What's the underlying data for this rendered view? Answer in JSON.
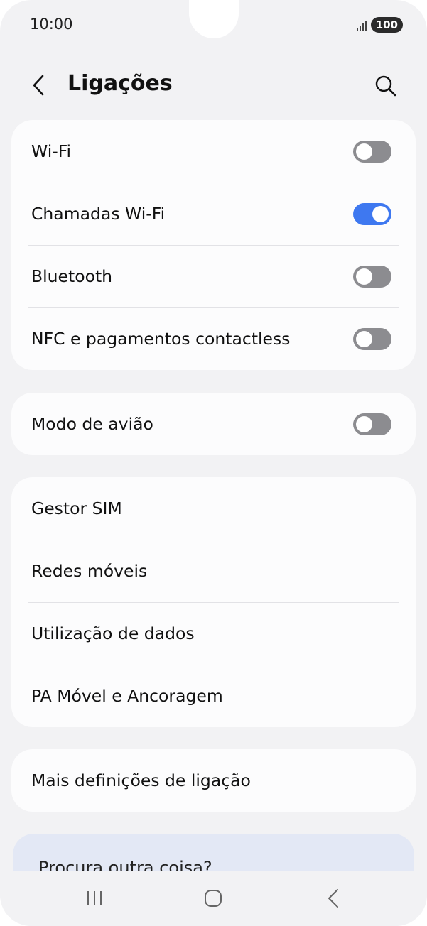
{
  "status_bar": {
    "time": "10:00",
    "battery": "100"
  },
  "header": {
    "title": "Ligações"
  },
  "cards": [
    {
      "rows": [
        {
          "label": "Wi-Fi",
          "toggle": "off"
        },
        {
          "label": "Chamadas Wi-Fi",
          "toggle": "on"
        },
        {
          "label": "Bluetooth",
          "toggle": "off"
        },
        {
          "label": "NFC e pagamentos contactless",
          "toggle": "off"
        }
      ]
    },
    {
      "rows": [
        {
          "label": "Modo de avião",
          "toggle": "off"
        }
      ]
    },
    {
      "rows": [
        {
          "label": "Gestor SIM"
        },
        {
          "label": "Redes móveis"
        },
        {
          "label": "Utilização de dados"
        },
        {
          "label": "PA Móvel e Ancoragem"
        }
      ]
    },
    {
      "rows": [
        {
          "label": "Mais definições de ligação"
        }
      ]
    }
  ],
  "suggestion": {
    "text": "Procura outra coisa?"
  },
  "colors": {
    "toggle_on": "#3e78f0",
    "toggle_off": "#8c8c90",
    "background": "#f2f2f4",
    "card": "#fcfcfd"
  },
  "icons": [
    "back-icon",
    "search-icon",
    "signal-icon",
    "nav-recents-icon",
    "nav-home-icon",
    "nav-back-icon"
  ]
}
